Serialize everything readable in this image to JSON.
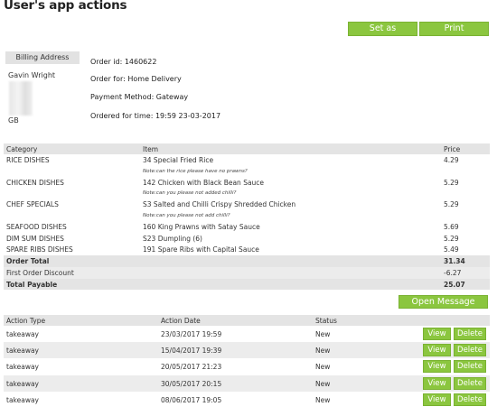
{
  "page": {
    "title": "User's app actions"
  },
  "toolbar": {
    "complete_label": "Set as Complete",
    "print_label": "Print"
  },
  "billing": {
    "header": "Billing Address",
    "name": "Gavin Wright",
    "country": "GB"
  },
  "order": {
    "id_line": "Order id: 1460622",
    "for_line": "Order for: Home Delivery",
    "payment_line": "Payment Method: Gateway",
    "time_line": "Ordered for time: 19:59 23-03-2017"
  },
  "items_table": {
    "headers": {
      "category": "Category",
      "item": "Item",
      "price": "Price"
    },
    "rows": [
      {
        "category": "RICE DISHES",
        "item": "34 Special Fried Rice",
        "price": "4.29",
        "note": "Note:can the rice please have no prawns?"
      },
      {
        "category": "CHICKEN DISHES",
        "item": "142 Chicken with Black Bean Sauce",
        "price": "5.29",
        "note": "Note:can you please not added chilli?"
      },
      {
        "category": "CHEF SPECIALS",
        "item": "S3 Salted and Chilli Crispy Shredded Chicken",
        "price": "5.29",
        "note": "Note:can you please not add chilli?"
      },
      {
        "category": "SEAFOOD DISHES",
        "item": "160 King Prawns with Satay Sauce",
        "price": "5.69",
        "note": ""
      },
      {
        "category": "DIM SUM DISHES",
        "item": "S23 Dumpling (6)",
        "price": "5.29",
        "note": ""
      },
      {
        "category": "SPARE RIBS DISHES",
        "item": "191 Spare Ribs with Capital Sauce",
        "price": "5.49",
        "note": ""
      }
    ],
    "order_total_label": "Order Total",
    "order_total_value": "31.34",
    "discount_label": "First Order Discount",
    "discount_value": "-6.27",
    "payable_label": "Total Payable",
    "payable_value": "25.07"
  },
  "message_centre": {
    "label": "Open Message Centre"
  },
  "actions_table": {
    "headers": {
      "type": "Action Type",
      "date": "Action Date",
      "status": "Status"
    },
    "view_label": "View",
    "delete_label": "Delete",
    "rows": [
      {
        "type": "takeaway",
        "date": "23/03/2017 19:59",
        "status": "New"
      },
      {
        "type": "takeaway",
        "date": "15/04/2017 19:39",
        "status": "New"
      },
      {
        "type": "takeaway",
        "date": "20/05/2017 21:23",
        "status": "New"
      },
      {
        "type": "takeaway",
        "date": "30/05/2017 20:15",
        "status": "New"
      },
      {
        "type": "takeaway",
        "date": "08/06/2017 19:05",
        "status": "New"
      }
    ]
  },
  "colors": {
    "accent": "#8bc63f",
    "header_bg": "#e4e4e4",
    "alt_row_bg": "#ececec"
  }
}
